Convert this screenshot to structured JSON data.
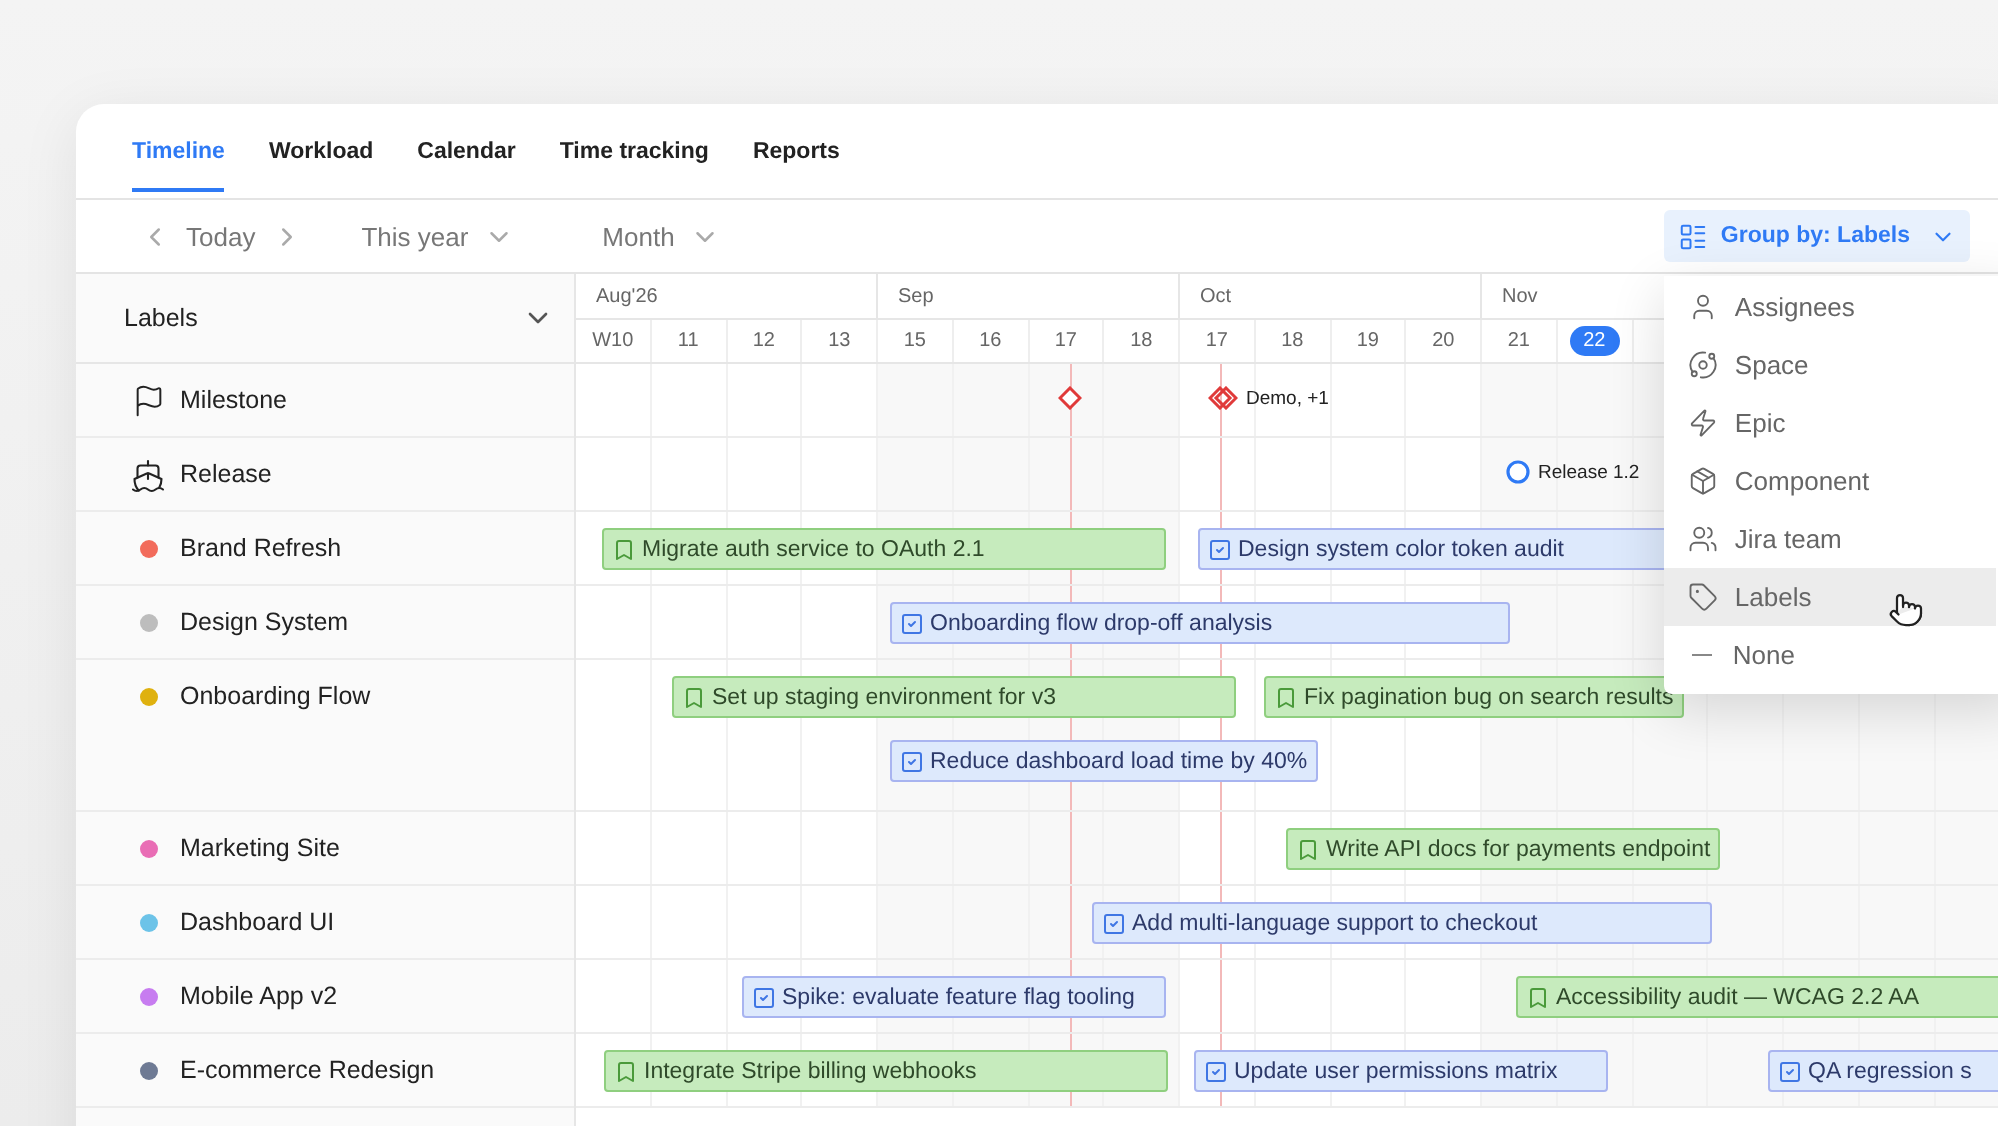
{
  "tabs": [
    {
      "label": "Timeline",
      "selected": true
    },
    {
      "label": "Workload",
      "selected": false
    },
    {
      "label": "Calendar",
      "selected": false
    },
    {
      "label": "Time tracking",
      "selected": false
    },
    {
      "label": "Reports",
      "selected": false
    }
  ],
  "toolbar": {
    "today": "Today",
    "range": "This year",
    "scale": "Month"
  },
  "group_by": {
    "label": "Group by: Labels",
    "expanded": true,
    "options": [
      {
        "kind": "user",
        "label": "Assignees",
        "selected": false
      },
      {
        "kind": "planet",
        "label": "Space",
        "selected": false
      },
      {
        "kind": "bolt",
        "label": "Epic",
        "selected": false
      },
      {
        "kind": "box",
        "label": "Component",
        "selected": false
      },
      {
        "kind": "team",
        "label": "Jira team",
        "selected": false
      },
      {
        "kind": "tag",
        "label": "Labels",
        "selected": true
      },
      {
        "kind": "none",
        "label": "None",
        "selected": false
      }
    ]
  },
  "sidebar_header": "Labels",
  "months": [
    {
      "label": "Aug'26",
      "days": [
        {
          "label": "W10",
          "today": false
        },
        {
          "label": "11",
          "today": false
        },
        {
          "label": "12",
          "today": false
        },
        {
          "label": "13",
          "today": false
        }
      ]
    },
    {
      "label": "Sep",
      "days": [
        {
          "label": "15",
          "today": false
        },
        {
          "label": "16",
          "today": false
        },
        {
          "label": "17",
          "today": false
        },
        {
          "label": "18",
          "today": false
        }
      ]
    },
    {
      "label": "Oct",
      "days": [
        {
          "label": "17",
          "today": false
        },
        {
          "label": "18",
          "today": false
        },
        {
          "label": "19",
          "today": false
        },
        {
          "label": "20",
          "today": false
        }
      ]
    },
    {
      "label": "Nov",
      "days": [
        {
          "label": "21",
          "today": false
        },
        {
          "label": "22",
          "today": true
        }
      ]
    }
  ],
  "rows": [
    {
      "kind": "milestone",
      "label": "Milestone",
      "markers": [
        {
          "kind": "diamond"
        },
        {
          "kind": "double-diamond",
          "label": "Demo, +1"
        }
      ]
    },
    {
      "kind": "release",
      "label": "Release",
      "markers": [
        {
          "kind": "circle",
          "label": "Release 1.2"
        }
      ]
    },
    {
      "kind": "label",
      "label": "Brand Refresh",
      "color": "#f26b5b",
      "lanes": [
        [
          {
            "kind": "story",
            "title": "Migrate auth service to OAuth 2.1"
          },
          {
            "kind": "task",
            "title": "Design system color token audit"
          }
        ]
      ]
    },
    {
      "kind": "label",
      "label": "Design System",
      "color": "#bdbdbd",
      "lanes": [
        [
          {
            "kind": "task",
            "title": "Onboarding flow drop-off analysis"
          }
        ]
      ]
    },
    {
      "kind": "label",
      "label": "Onboarding Flow",
      "color": "#dfb10f",
      "lanes": [
        [
          {
            "kind": "story",
            "title": "Set up staging environment for v3"
          },
          {
            "kind": "story",
            "title": "Fix pagination bug on search results"
          }
        ],
        [
          {
            "kind": "task",
            "title": "Reduce dashboard load time by 40%"
          }
        ]
      ]
    },
    {
      "kind": "label",
      "label": "Marketing Site",
      "color": "#e96db5",
      "lanes": [
        [
          {
            "kind": "story",
            "title": "Write API docs for payments endpoint"
          }
        ]
      ]
    },
    {
      "kind": "label",
      "label": "Dashboard UI",
      "color": "#6cc3e8",
      "lanes": [
        [
          {
            "kind": "task",
            "title": "Add multi-language support to checkout"
          }
        ]
      ]
    },
    {
      "kind": "label",
      "label": "Mobile App v2",
      "color": "#c77cf0",
      "lanes": [
        [
          {
            "kind": "task",
            "title": "Spike: evaluate feature flag tooling"
          },
          {
            "kind": "story",
            "title": "Accessibility audit — WCAG 2.2 AA"
          }
        ]
      ]
    },
    {
      "kind": "label",
      "label": "E-commerce Redesign",
      "color": "#6e7a94",
      "lanes": [
        [
          {
            "kind": "story",
            "title": "Integrate Stripe billing webhooks"
          },
          {
            "kind": "task",
            "title": "Update user permissions matrix"
          },
          {
            "kind": "task",
            "title": "QA regression s"
          }
        ]
      ]
    }
  ]
}
